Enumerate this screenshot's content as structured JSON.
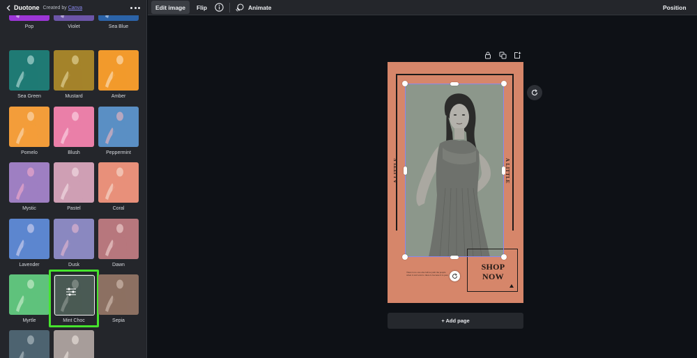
{
  "sidebar": {
    "title": "Duotone",
    "credit": "Created by",
    "credit_link": "Canva",
    "filters": [
      {
        "label": "Pop",
        "bg": "#9c36d6",
        "fg": "#c99ae8"
      },
      {
        "label": "Violet",
        "bg": "#6c55a8",
        "fg": "#b3a2d6"
      },
      {
        "label": "Sea Blue",
        "bg": "#2c63a8",
        "fg": "#8fb0da"
      },
      {
        "label": "Sea Green",
        "bg": "#1f7a74",
        "fg": "#7fb9b4"
      },
      {
        "label": "Mustard",
        "bg": "#a4832a",
        "fg": "#cdb873"
      },
      {
        "label": "Amber",
        "bg": "#f29a2c",
        "fg": "#f8c789"
      },
      {
        "label": "Pomelo",
        "bg": "#f39d3a",
        "fg": "#f8c489"
      },
      {
        "label": "Blush",
        "bg": "#ea7fa8",
        "fg": "#f5b7cf"
      },
      {
        "label": "Peppermint",
        "bg": "#5a8fc4",
        "fg": "#b7a7bf"
      },
      {
        "label": "Mystic",
        "bg": "#9e7fc2",
        "fg": "#d39ac7"
      },
      {
        "label": "Pastel",
        "bg": "#cf9fb4",
        "fg": "#e6c7d3"
      },
      {
        "label": "Coral",
        "bg": "#e8907a",
        "fg": "#f1c0b0"
      },
      {
        "label": "Lavender",
        "bg": "#5c86cf",
        "fg": "#a7b6e3"
      },
      {
        "label": "Dusk",
        "bg": "#8a88c0",
        "fg": "#c3a5c9"
      },
      {
        "label": "Dawn",
        "bg": "#b7777d",
        "fg": "#dbb1b2"
      },
      {
        "label": "Myrtle",
        "bg": "#5fc27c",
        "fg": "#a5deb1"
      },
      {
        "label": "Mint Choc",
        "bg": "#4a5a54",
        "fg": "#77837d"
      },
      {
        "label": "Sepia",
        "bg": "#8c7062",
        "fg": "#b9a295"
      },
      {
        "label": "",
        "bg": "#4d6370",
        "fg": "#8e9ea6"
      },
      {
        "label": "",
        "bg": "#a79d9a",
        "fg": "#d2c9c4"
      }
    ],
    "selected": "Mint Choc"
  },
  "toolbar": {
    "edit_image": "Edit image",
    "flip": "Flip",
    "animate": "Animate",
    "position": "Position"
  },
  "design": {
    "vertical_text_left": "A LITTLE",
    "vertical_text_right": "A LITTLE",
    "shop_line1": "SHOP",
    "shop_line2": "NOW",
    "small_copy": "There is no one else before path the people when it and want to there is because it is past."
  },
  "canvas": {
    "add_page": "+ Add page"
  },
  "colors": {
    "accent_select": "#46e42e",
    "selection_outline": "#8b87ef",
    "design_bg": "#d6866a"
  }
}
